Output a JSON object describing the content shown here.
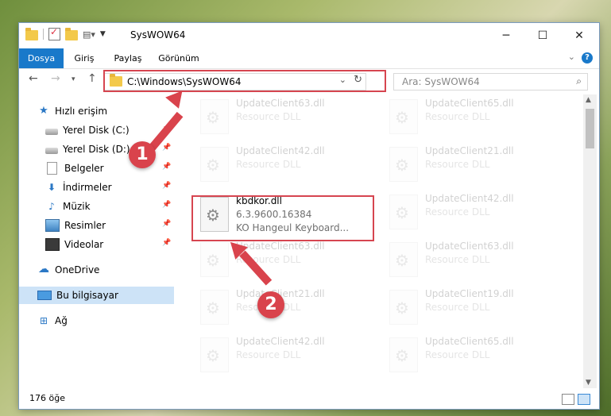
{
  "window": {
    "title": "SysWOW64"
  },
  "ribbon": {
    "tabs": [
      "Dosya",
      "Giriş",
      "Paylaş",
      "Görünüm"
    ]
  },
  "address": {
    "path": "C:\\Windows\\SysWOW64"
  },
  "search": {
    "placeholder": "Ara: SysWOW64"
  },
  "navpane": {
    "items": [
      {
        "label": "Hızlı erişim",
        "icon": "star-icon"
      },
      {
        "label": "Yerel Disk (C:)",
        "icon": "disk-icon",
        "pinned": true
      },
      {
        "label": "Yerel Disk (D:)",
        "icon": "disk-icon",
        "pinned": true
      },
      {
        "label": "Belgeler",
        "icon": "document-icon",
        "pinned": true
      },
      {
        "label": "İndirmeler",
        "icon": "download-icon",
        "pinned": true
      },
      {
        "label": "Müzik",
        "icon": "music-icon",
        "pinned": true
      },
      {
        "label": "Resimler",
        "icon": "pictures-icon",
        "pinned": true
      },
      {
        "label": "Videolar",
        "icon": "videos-icon",
        "pinned": true
      },
      {
        "label": "OneDrive",
        "icon": "cloud-icon"
      },
      {
        "label": "Bu bilgisayar",
        "icon": "computer-icon",
        "selected": true
      },
      {
        "label": "Ağ",
        "icon": "network-icon"
      }
    ]
  },
  "files": [
    {
      "name": "UpdateClient63.dll",
      "line2": "Resource DLL",
      "line3": "",
      "faded": true
    },
    {
      "name": "UpdateClient65.dll",
      "line2": "Resource DLL",
      "line3": "",
      "faded": true
    },
    {
      "name": "UpdateClient42.dll",
      "line2": "Resource DLL",
      "line3": "",
      "faded": true
    },
    {
      "name": "UpdateClient21.dll",
      "line2": "Resource DLL",
      "line3": "",
      "faded": true
    },
    {
      "name": "kbdkor.dll",
      "line2": "6.3.9600.16384",
      "line3": "KO Hangeul Keyboard...",
      "faded": false
    },
    {
      "name": "UpdateClient42.dll",
      "line2": "Resource DLL",
      "line3": "",
      "faded": true
    },
    {
      "name": "UpdateClient63.dll",
      "line2": "Resource DLL",
      "line3": "",
      "faded": true
    },
    {
      "name": "UpdateClient63.dll",
      "line2": "Resource DLL",
      "line3": "",
      "faded": true
    },
    {
      "name": "UpdateClient21.dll",
      "line2": "Resource DLL",
      "line3": "",
      "faded": true
    },
    {
      "name": "UpdateClient19.dll",
      "line2": "Resource DLL",
      "line3": "",
      "faded": true
    },
    {
      "name": "UpdateClient42.dll",
      "line2": "Resource DLL",
      "line3": "",
      "faded": true
    },
    {
      "name": "UpdateClient65.dll",
      "line2": "Resource DLL",
      "line3": "",
      "faded": true
    }
  ],
  "status": {
    "count": "176 öğe"
  },
  "annotations": {
    "step1": "1",
    "step2": "2"
  },
  "colors": {
    "accent": "#1979ca",
    "highlight": "#d64550"
  }
}
